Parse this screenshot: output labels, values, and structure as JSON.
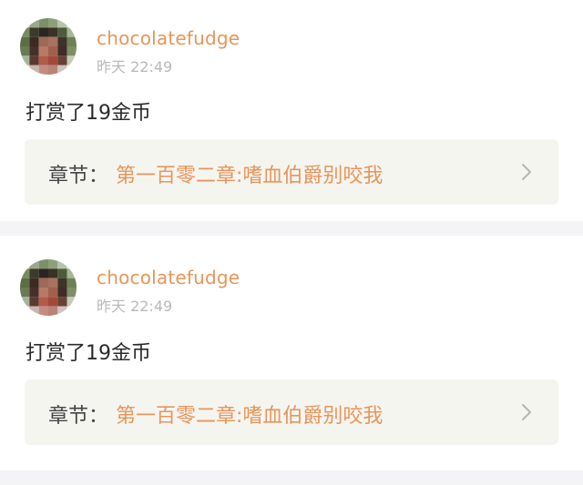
{
  "posts": [
    {
      "username": "chocolatefudge",
      "timestamp": "昨天 22:49",
      "message": "打赏了19金币",
      "chapter_prefix": "章节：",
      "chapter_title": "第一百零二章:嗜血伯爵别咬我"
    },
    {
      "username": "chocolatefudge",
      "timestamp": "昨天 22:49",
      "message": "打赏了19金币",
      "chapter_prefix": "章节：",
      "chapter_title": "第一百零二章:嗜血伯爵别咬我"
    }
  ],
  "icons": {
    "chevron": "chevron-right-icon",
    "avatar": "pixelated-avatar"
  },
  "colors": {
    "accent": "#e8955a",
    "timestamp": "#b9b9b9",
    "card_bg": "#f5f5f0",
    "separator": "#f4f4f6",
    "text": "#2b2b2b"
  }
}
